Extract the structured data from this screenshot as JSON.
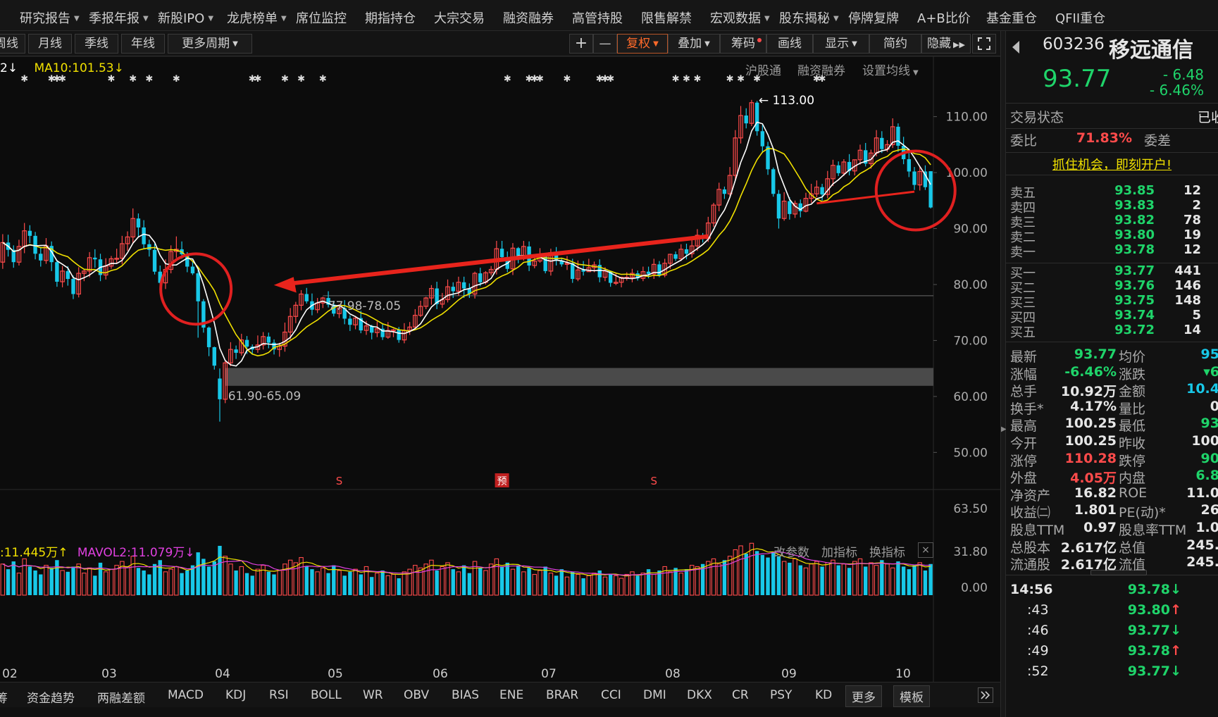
{
  "topnav": [
    "研究报告",
    "季报年报",
    "新股IPO",
    "龙虎榜单",
    "席位监控",
    "期指持仓",
    "大宗交易",
    "融资融券",
    "高管持股",
    "限售解禁",
    "宏观数据",
    "股东揭秘",
    "停牌复牌",
    "A+B比价",
    "基金重仓",
    "QFII重仓"
  ],
  "period_buttons": [
    "周线",
    "月线",
    "季线",
    "年线",
    "更多周期"
  ],
  "toolbar": {
    "plus": "+",
    "minus": "—",
    "fuquan": "复权",
    "diejia": "叠加",
    "chouma": "筹码",
    "huaxian": "画线",
    "xianshi": "显示",
    "jianyue": "简约",
    "yincang": "隐藏",
    "expand_icon": "expand-icon"
  },
  "ma_legend": {
    "ma5": "2",
    "ma5_arrow": "↓",
    "ma10": "MA10:101.53",
    "ma10_arrow": "↓",
    "ma5_color": "#ffffff",
    "ma10_color": "#f0e000"
  },
  "chart_links": {
    "hgt": "沪股通",
    "rzrq": "融资融券",
    "shezhi": "设置均线"
  },
  "vol_legend": {
    "mavol1": ":11.445万",
    "mavol1_arrow": "↑",
    "mavol2": "MAVOL2:11.079万",
    "mavol2_arrow": "↓",
    "mavol1_color": "#f0e000",
    "mavol2_color": "#e040e0"
  },
  "vol_links": {
    "gai": "改参数",
    "jia": "加指标",
    "huan": "换指标",
    "close": "×"
  },
  "chart_data": {
    "type": "candlestick",
    "price_axis": [
      "110.00",
      "100.00",
      "90.00",
      "80.00",
      "70.00",
      "60.00",
      "50.00"
    ],
    "volume_axis": [
      "63.50",
      "31.80",
      "0.00"
    ],
    "months": [
      "02",
      "03",
      "04",
      "05",
      "06",
      "07",
      "08",
      "09",
      "10"
    ],
    "annotations": {
      "high": "113.00",
      "gap": "61.90-65.09",
      "support": "77.98-78.05"
    },
    "event_markers": [
      "S",
      "预",
      "S"
    ],
    "colors": {
      "up": "#ff4b4b",
      "down": "#18c8e8",
      "ma5": "#ffffff",
      "ma10": "#f0e000",
      "arrow": "#e8241c",
      "circle": "#e02020",
      "gapbox": "#4a4a4a"
    },
    "candles": [
      [
        84.0,
        87.5,
        82.8,
        89.0
      ],
      [
        87.5,
        86.2,
        85.0,
        88.9
      ],
      [
        86.2,
        84.0,
        83.0,
        87.0
      ],
      [
        84.0,
        86.8,
        83.4,
        88.0
      ],
      [
        86.8,
        89.6,
        85.6,
        91.0
      ],
      [
        89.6,
        88.7,
        87.4,
        90.6
      ],
      [
        88.7,
        85.5,
        84.5,
        89.4
      ],
      [
        85.5,
        84.3,
        83.2,
        86.7
      ],
      [
        84.3,
        86.9,
        83.7,
        88.3
      ],
      [
        86.9,
        84.0,
        82.4,
        87.7
      ],
      [
        84.0,
        80.5,
        79.6,
        84.4
      ],
      [
        80.5,
        82.4,
        79.5,
        83.3
      ],
      [
        82.4,
        81.0,
        79.8,
        83.3
      ],
      [
        81.0,
        78.3,
        77.4,
        81.6
      ],
      [
        78.3,
        82.0,
        77.7,
        83.1
      ],
      [
        82.0,
        82.4,
        80.6,
        82.8
      ],
      [
        82.4,
        84.8,
        81.3,
        85.8
      ],
      [
        84.8,
        84.5,
        83.0,
        86.3
      ],
      [
        84.5,
        81.7,
        80.6,
        85.5
      ],
      [
        81.7,
        83.3,
        80.9,
        84.7
      ],
      [
        83.3,
        84.6,
        82.8,
        85.1
      ],
      [
        84.6,
        84.7,
        83.8,
        86.4
      ],
      [
        84.7,
        87.3,
        83.6,
        88.7
      ],
      [
        87.3,
        88.5,
        86.0,
        89.5
      ],
      [
        88.5,
        91.8,
        87.3,
        93.6
      ],
      [
        91.8,
        90.2,
        88.4,
        92.7
      ],
      [
        90.2,
        87.2,
        86.4,
        91.5
      ],
      [
        87.2,
        86.2,
        85.0,
        88.0
      ],
      [
        86.2,
        82.3,
        81.8,
        87.3
      ],
      [
        82.3,
        80.3,
        79.4,
        83.4
      ],
      [
        80.3,
        82.7,
        79.2,
        84.5
      ],
      [
        82.7,
        85.9,
        82.0,
        87.0
      ],
      [
        85.9,
        86.3,
        84.8,
        88.6
      ],
      [
        86.3,
        85.4,
        84.6,
        87.7
      ],
      [
        85.4,
        83.2,
        82.2,
        85.8
      ],
      [
        83.2,
        82.0,
        81.7,
        84.2
      ],
      [
        82.0,
        77.0,
        70.5,
        82.6
      ],
      [
        77.0,
        72.3,
        71.4,
        77.4
      ],
      [
        72.3,
        68.8,
        67.2,
        72.5
      ],
      [
        68.8,
        65.5,
        64.8,
        68.9
      ],
      [
        63.2,
        59.5,
        55.5,
        65.0
      ],
      [
        59.5,
        66.0,
        58.8,
        66.5
      ],
      [
        66.0,
        68.4,
        65.4,
        69.7
      ],
      [
        68.4,
        67.8,
        66.7,
        69.1
      ],
      [
        67.8,
        70.1,
        67.3,
        71.2
      ],
      [
        70.1,
        68.9,
        67.6,
        70.8
      ],
      [
        68.9,
        68.4,
        67.6,
        69.3
      ],
      [
        68.4,
        69.2,
        67.8,
        70.9
      ],
      [
        69.2,
        70.7,
        68.4,
        71.5
      ],
      [
        70.7,
        69.6,
        68.6,
        71.4
      ],
      [
        69.6,
        68.4,
        67.5,
        70.2
      ],
      [
        68.4,
        69.0,
        67.1,
        69.6
      ],
      [
        69.0,
        71.5,
        68.0,
        73.2
      ],
      [
        71.5,
        74.3,
        70.2,
        75.8
      ],
      [
        74.3,
        76.3,
        73.1,
        76.9
      ],
      [
        76.3,
        78.3,
        75.4,
        79.0
      ],
      [
        78.3,
        77.0,
        76.6,
        79.4
      ],
      [
        77.0,
        75.5,
        74.5,
        78.4
      ],
      [
        75.5,
        76.7,
        74.9,
        77.6
      ],
      [
        76.7,
        77.6,
        75.8,
        77.8
      ],
      [
        77.6,
        76.4,
        75.9,
        78.8
      ],
      [
        76.4,
        74.8,
        74.3,
        77.1
      ],
      [
        74.8,
        75.8,
        74.0,
        76.5
      ],
      [
        75.8,
        73.9,
        72.9,
        77.2
      ],
      [
        73.9,
        72.8,
        71.7,
        74.5
      ],
      [
        72.8,
        74.0,
        72.0,
        74.4
      ],
      [
        74.0,
        71.8,
        71.3,
        75.3
      ],
      [
        71.8,
        72.6,
        71.0,
        73.5
      ],
      [
        72.6,
        71.4,
        70.2,
        72.8
      ],
      [
        71.4,
        72.1,
        70.6,
        73.4
      ],
      [
        72.1,
        70.6,
        70.1,
        72.9
      ],
      [
        70.6,
        71.8,
        70.3,
        73.3
      ],
      [
        71.8,
        71.9,
        70.6,
        72.1
      ],
      [
        71.9,
        70.1,
        69.6,
        72.4
      ],
      [
        70.1,
        71.8,
        69.5,
        73.1
      ],
      [
        71.8,
        72.4,
        71.0,
        73.3
      ],
      [
        72.4,
        74.5,
        72.1,
        75.6
      ],
      [
        74.5,
        76.1,
        74.2,
        77.1
      ],
      [
        76.1,
        77.6,
        75.6,
        77.8
      ],
      [
        77.6,
        79.3,
        76.4,
        79.9
      ],
      [
        79.3,
        76.5,
        75.6,
        80.5
      ],
      [
        76.5,
        77.3,
        75.8,
        78.5
      ],
      [
        77.3,
        79.6,
        76.8,
        80.9
      ],
      [
        79.6,
        78.8,
        77.6,
        80.4
      ],
      [
        78.8,
        80.4,
        78.0,
        81.4
      ],
      [
        80.4,
        79.3,
        77.6,
        81.4
      ],
      [
        79.3,
        78.3,
        77.6,
        80.2
      ],
      [
        78.3,
        82.0,
        77.5,
        82.3
      ],
      [
        82.0,
        80.4,
        79.7,
        83.0
      ],
      [
        80.4,
        82.1,
        80.0,
        82.4
      ],
      [
        82.1,
        82.7,
        81.6,
        83.3
      ],
      [
        82.7,
        86.4,
        81.8,
        87.8
      ],
      [
        86.4,
        84.9,
        84.1,
        87.8
      ],
      [
        84.9,
        82.8,
        82.2,
        85.9
      ],
      [
        82.8,
        86.5,
        81.7,
        87.4
      ],
      [
        86.5,
        85.0,
        83.8,
        86.7
      ],
      [
        85.0,
        86.8,
        84.3,
        87.8
      ],
      [
        86.8,
        83.4,
        82.4,
        87.7
      ],
      [
        83.4,
        84.2,
        82.9,
        85.2
      ],
      [
        84.2,
        85.2,
        83.9,
        86.5
      ],
      [
        85.2,
        82.4,
        82.0,
        85.6
      ],
      [
        82.4,
        85.7,
        81.6,
        86.4
      ],
      [
        85.7,
        84.3,
        83.4,
        86.7
      ],
      [
        84.3,
        83.6,
        83.2,
        84.7
      ],
      [
        83.6,
        83.8,
        82.6,
        85.1
      ],
      [
        83.8,
        81.0,
        80.3,
        84.6
      ],
      [
        81.0,
        82.6,
        80.6,
        84.3
      ],
      [
        82.6,
        82.3,
        81.6,
        84.2
      ],
      [
        82.3,
        83.0,
        82.3,
        84.6
      ],
      [
        83.0,
        83.5,
        82.2,
        84.1
      ],
      [
        83.5,
        81.3,
        80.4,
        84.5
      ],
      [
        81.3,
        82.4,
        80.6,
        83.1
      ],
      [
        82.4,
        80.3,
        79.6,
        82.5
      ],
      [
        80.3,
        80.4,
        79.9,
        82.0
      ],
      [
        80.4,
        81.3,
        79.5,
        81.4
      ],
      [
        81.3,
        81.3,
        80.7,
        82.2
      ],
      [
        81.3,
        82.0,
        80.4,
        82.8
      ],
      [
        82.0,
        81.1,
        80.7,
        82.5
      ],
      [
        81.1,
        82.3,
        80.6,
        83.2
      ],
      [
        82.3,
        81.9,
        81.1,
        83.2
      ],
      [
        81.9,
        83.6,
        81.0,
        84.6
      ],
      [
        83.6,
        81.7,
        81.3,
        84.2
      ],
      [
        81.7,
        83.8,
        81.3,
        84.6
      ],
      [
        83.8,
        85.4,
        82.8,
        85.5
      ],
      [
        85.4,
        84.6,
        84.2,
        85.9
      ],
      [
        84.6,
        86.3,
        84.2,
        87.2
      ],
      [
        86.3,
        85.5,
        84.5,
        87.3
      ],
      [
        85.5,
        86.9,
        84.8,
        88.0
      ],
      [
        86.9,
        88.8,
        86.0,
        89.9
      ],
      [
        88.8,
        88.2,
        87.5,
        89.2
      ],
      [
        88.2,
        91.0,
        87.6,
        92.1
      ],
      [
        91.0,
        94.2,
        90.3,
        94.6
      ],
      [
        94.2,
        97.0,
        93.1,
        98.2
      ],
      [
        97.0,
        96.2,
        95.3,
        97.5
      ],
      [
        96.2,
        99.5,
        95.7,
        101.0
      ],
      [
        99.5,
        106.2,
        98.6,
        107.6
      ],
      [
        106.2,
        110.2,
        105.2,
        111.9
      ],
      [
        110.2,
        108.8,
        107.9,
        111.5
      ],
      [
        108.8,
        112.5,
        108.3,
        113.0
      ],
      [
        112.5,
        107.4,
        106.6,
        112.8
      ],
      [
        107.4,
        104.7,
        103.5,
        108.5
      ],
      [
        104.7,
        100.6,
        99.6,
        105.5
      ],
      [
        100.6,
        96.2,
        95.7,
        100.9
      ],
      [
        96.2,
        91.8,
        90.0,
        96.9
      ],
      [
        91.8,
        94.9,
        91.4,
        96.5
      ],
      [
        94.9,
        92.6,
        91.6,
        95.6
      ],
      [
        92.6,
        94.5,
        91.9,
        95.0
      ],
      [
        94.5,
        93.1,
        92.0,
        95.2
      ],
      [
        93.1,
        95.4,
        92.9,
        96.4
      ],
      [
        95.4,
        96.2,
        94.6,
        98.0
      ],
      [
        96.2,
        97.4,
        95.6,
        98.6
      ],
      [
        97.4,
        96.1,
        95.0,
        98.0
      ],
      [
        96.1,
        98.9,
        95.4,
        100.3
      ],
      [
        98.9,
        101.3,
        97.6,
        102.3
      ],
      [
        101.3,
        99.9,
        99.4,
        102.0
      ],
      [
        99.9,
        101.9,
        99.4,
        102.4
      ],
      [
        101.9,
        100.3,
        99.5,
        103.3
      ],
      [
        100.3,
        102.3,
        99.5,
        102.3
      ],
      [
        102.3,
        104.0,
        101.4,
        105.0
      ],
      [
        104.0,
        101.6,
        101.1,
        105.3
      ],
      [
        101.6,
        103.5,
        100.7,
        104.1
      ],
      [
        103.5,
        106.2,
        102.9,
        107.6
      ],
      [
        106.2,
        104.2,
        103.5,
        107.4
      ],
      [
        104.2,
        105.0,
        103.7,
        105.8
      ],
      [
        105.0,
        108.2,
        104.4,
        109.7
      ],
      [
        108.2,
        104.8,
        103.7,
        108.8
      ],
      [
        104.8,
        102.4,
        101.5,
        106.4
      ],
      [
        102.4,
        100.2,
        99.2,
        103.5
      ],
      [
        100.2,
        97.8,
        96.9,
        101.0
      ],
      [
        97.8,
        100.2,
        96.8,
        101.0
      ],
      [
        100.2,
        97.4,
        96.9,
        101.3
      ],
      [
        100.25,
        93.77,
        93.6,
        100.25
      ]
    ],
    "volumes": [
      24,
      20,
      26,
      17,
      28,
      22,
      19,
      16,
      23,
      21,
      27,
      19,
      18,
      22,
      24,
      17,
      21,
      15,
      25,
      18,
      20,
      23,
      26,
      22,
      30,
      21,
      19,
      16,
      24,
      27,
      18,
      20,
      22,
      17,
      19,
      23,
      33,
      28,
      22,
      26,
      38,
      30,
      24,
      19,
      22,
      17,
      15,
      20,
      23,
      18,
      16,
      19,
      24,
      27,
      25,
      29,
      22,
      20,
      18,
      21,
      17,
      23,
      19,
      15,
      18,
      20,
      16,
      22,
      14,
      17,
      19,
      15,
      16,
      13,
      18,
      20,
      23,
      21,
      24,
      27,
      19,
      22,
      25,
      20,
      18,
      23,
      17,
      26,
      21,
      19,
      24,
      28,
      22,
      25,
      20,
      23,
      18,
      21,
      16,
      19,
      22,
      17,
      15,
      20,
      14,
      18,
      16,
      13,
      15,
      17,
      19,
      14,
      16,
      15,
      13,
      16,
      18,
      15,
      17,
      20,
      16,
      19,
      22,
      18,
      21,
      17,
      20,
      23,
      22,
      24,
      26,
      28,
      24,
      27,
      30,
      35,
      38,
      32,
      40,
      34,
      31,
      29,
      33,
      30,
      26,
      25,
      28,
      23,
      21,
      24,
      26,
      22,
      25,
      27,
      23,
      24,
      21,
      26,
      28,
      22,
      25,
      23,
      27,
      24,
      21,
      26,
      22,
      20,
      23,
      25,
      19,
      24
    ]
  },
  "stock": {
    "code": "603236",
    "name": "移远通信",
    "price": "93.77",
    "change": "- 6.48",
    "pct": "- 6.46%"
  },
  "status": {
    "jiaoyi_label": "交易状态",
    "jiaoyi_value": "已收",
    "weibi_label": "委比",
    "weibi_value": "71.83%",
    "weicha_label": "委差",
    "promo": "抓住机会，即刻开户!"
  },
  "orderbook": {
    "sells": [
      [
        "卖五",
        "93.85",
        "12"
      ],
      [
        "卖四",
        "93.83",
        "2"
      ],
      [
        "卖三",
        "93.82",
        "78"
      ],
      [
        "卖二",
        "93.80",
        "19"
      ],
      [
        "卖一",
        "93.78",
        "12"
      ]
    ],
    "buys": [
      [
        "买一",
        "93.77",
        "441"
      ],
      [
        "买二",
        "93.76",
        "146"
      ],
      [
        "买三",
        "93.75",
        "148"
      ],
      [
        "买四",
        "93.74",
        "5"
      ],
      [
        "买五",
        "93.72",
        "14"
      ]
    ]
  },
  "stats": [
    [
      "最新",
      "93.77",
      "均价",
      "95"
    ],
    [
      "涨幅",
      "-6.46%",
      "涨跌",
      "▾6"
    ],
    [
      "总手",
      "10.92万",
      "金额",
      "10.4"
    ],
    [
      "换手*",
      "4.17%",
      "量比",
      "0"
    ],
    [
      "最高",
      "100.25",
      "最低",
      "93"
    ],
    [
      "今开",
      "100.25",
      "昨收",
      "100"
    ],
    [
      "涨停",
      "110.28",
      "跌停",
      "90"
    ],
    [
      "外盘",
      "4.05万",
      "内盘",
      "6.8"
    ],
    [
      "净资产",
      "16.82",
      "ROE",
      "11.0"
    ],
    [
      "收益㈡",
      "1.801",
      "PE(动)*",
      "26"
    ],
    [
      "股息TTM",
      "0.97",
      "股息率TTM",
      "1.0"
    ],
    [
      "总股本",
      "2.617亿",
      "总值",
      "245."
    ],
    [
      "流通股",
      "2.617亿",
      "流值",
      "245."
    ]
  ],
  "ticks": [
    [
      "14:56",
      "93.78",
      "↓"
    ],
    [
      ":43",
      "93.80",
      "↑"
    ],
    [
      ":46",
      "93.77",
      "↓"
    ],
    [
      ":49",
      "93.78",
      "↑"
    ],
    [
      ":52",
      "93.77",
      "↓"
    ]
  ],
  "indicators": [
    "筹",
    "资金趋势",
    "两融差额",
    "MACD",
    "KDJ",
    "RSI",
    "BOLL",
    "WR",
    "OBV",
    "BIAS",
    "ENE",
    "BRAR",
    "CCI",
    "DMI",
    "DKX",
    "CR",
    "PSY",
    "KD",
    "更多",
    "模板"
  ]
}
